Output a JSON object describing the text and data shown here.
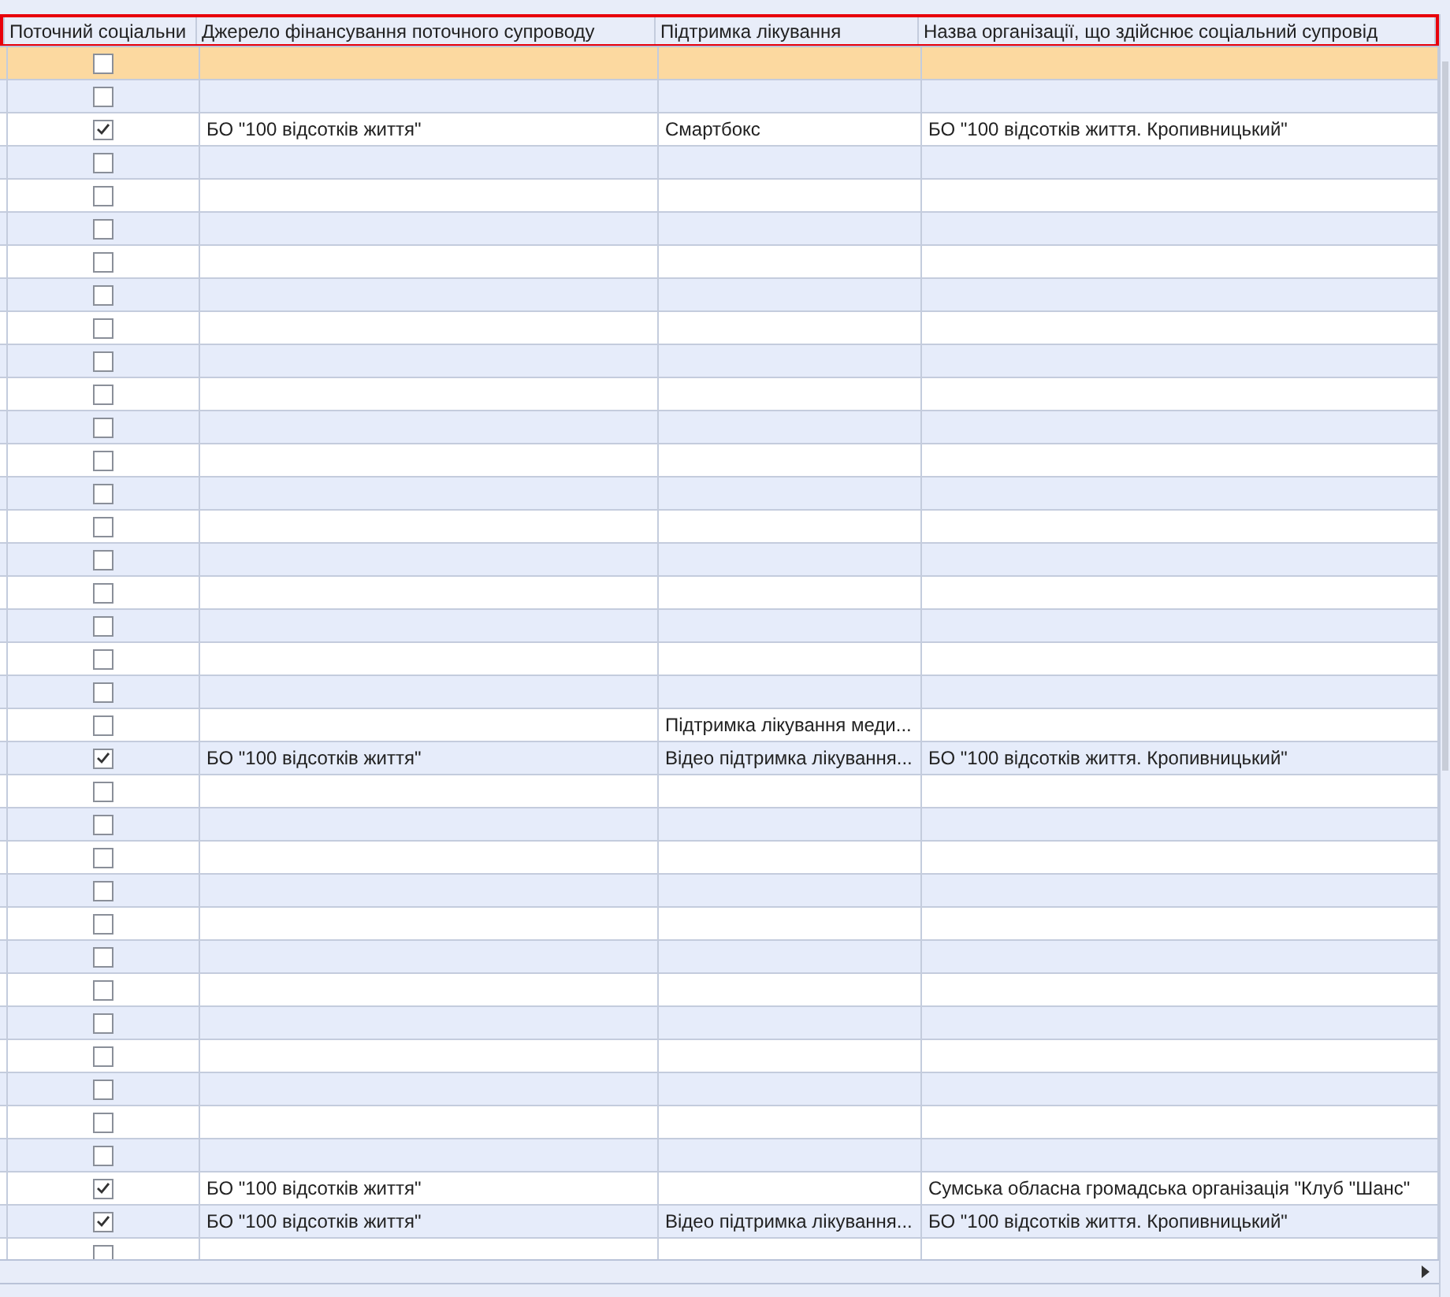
{
  "table": {
    "columns": [
      "Поточний соціальни",
      "Джерело фінансування поточного супроводу",
      "Підтримка лікування",
      "Назва організації, що здійснює соціальний супровід"
    ],
    "rows": [
      {
        "selected": true,
        "checked": false
      },
      {
        "selected": false,
        "checked": false
      },
      {
        "selected": false,
        "checked": true,
        "funding": "БО \"100 відсотків життя\"",
        "treatment": "Смартбокс",
        "organization": "БО \"100 відсотків життя. Кропивницький\""
      },
      {
        "selected": false,
        "checked": false
      },
      {
        "selected": false,
        "checked": false
      },
      {
        "selected": false,
        "checked": false
      },
      {
        "selected": false,
        "checked": false
      },
      {
        "selected": false,
        "checked": false
      },
      {
        "selected": false,
        "checked": false
      },
      {
        "selected": false,
        "checked": false
      },
      {
        "selected": false,
        "checked": false
      },
      {
        "selected": false,
        "checked": false
      },
      {
        "selected": false,
        "checked": false
      },
      {
        "selected": false,
        "checked": false
      },
      {
        "selected": false,
        "checked": false
      },
      {
        "selected": false,
        "checked": false
      },
      {
        "selected": false,
        "checked": false
      },
      {
        "selected": false,
        "checked": false
      },
      {
        "selected": false,
        "checked": false
      },
      {
        "selected": false,
        "checked": false
      },
      {
        "selected": false,
        "checked": false,
        "treatment": "Підтримка лікування меди..."
      },
      {
        "selected": false,
        "checked": true,
        "funding": "БО \"100 відсотків життя\"",
        "treatment": "Відео підтримка лікування...",
        "organization": "БО \"100 відсотків життя. Кропивницький\""
      },
      {
        "selected": false,
        "checked": false
      },
      {
        "selected": false,
        "checked": false
      },
      {
        "selected": false,
        "checked": false
      },
      {
        "selected": false,
        "checked": false
      },
      {
        "selected": false,
        "checked": false
      },
      {
        "selected": false,
        "checked": false
      },
      {
        "selected": false,
        "checked": false
      },
      {
        "selected": false,
        "checked": false
      },
      {
        "selected": false,
        "checked": false
      },
      {
        "selected": false,
        "checked": false
      },
      {
        "selected": false,
        "checked": false
      },
      {
        "selected": false,
        "checked": false
      },
      {
        "selected": false,
        "checked": true,
        "funding": "БО \"100 відсотків життя\"",
        "organization": "Сумська обласна громадська організація \"Клуб \"Шанс\""
      },
      {
        "selected": false,
        "checked": true,
        "funding": "БО \"100 відсотків життя\"",
        "treatment": "Відео підтримка лікування...",
        "organization": "БО \"100 відсотків життя. Кропивницький\""
      },
      {
        "selected": false,
        "checked": false
      }
    ]
  }
}
